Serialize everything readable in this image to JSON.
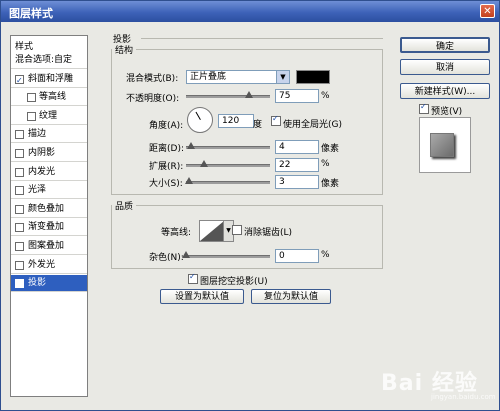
{
  "window": {
    "title": "图层样式",
    "close_glyph": "✕"
  },
  "left_panel": {
    "heading": "样式",
    "items": [
      {
        "label": "混合选项:自定",
        "checkbox": false,
        "checked": false,
        "indent": false,
        "selected": false
      },
      {
        "label": "斜面和浮雕",
        "checkbox": true,
        "checked": true,
        "indent": false,
        "selected": false
      },
      {
        "label": "等高线",
        "checkbox": true,
        "checked": false,
        "indent": true,
        "selected": false
      },
      {
        "label": "纹理",
        "checkbox": true,
        "checked": false,
        "indent": true,
        "selected": false
      },
      {
        "label": "描边",
        "checkbox": true,
        "checked": false,
        "indent": false,
        "selected": false
      },
      {
        "label": "内阴影",
        "checkbox": true,
        "checked": false,
        "indent": false,
        "selected": false
      },
      {
        "label": "内发光",
        "checkbox": true,
        "checked": false,
        "indent": false,
        "selected": false
      },
      {
        "label": "光泽",
        "checkbox": true,
        "checked": false,
        "indent": false,
        "selected": false
      },
      {
        "label": "颜色叠加",
        "checkbox": true,
        "checked": false,
        "indent": false,
        "selected": false
      },
      {
        "label": "渐变叠加",
        "checkbox": true,
        "checked": false,
        "indent": false,
        "selected": false
      },
      {
        "label": "图案叠加",
        "checkbox": true,
        "checked": false,
        "indent": false,
        "selected": false
      },
      {
        "label": "外发光",
        "checkbox": true,
        "checked": false,
        "indent": false,
        "selected": false
      },
      {
        "label": "投影",
        "checkbox": true,
        "checked": true,
        "indent": false,
        "selected": true
      }
    ]
  },
  "drop_shadow": {
    "section_title": "投影",
    "structure": {
      "title": "结构",
      "blend_mode_label": "混合模式(B):",
      "blend_mode_value": "正片叠底",
      "blend_color": "#000000",
      "opacity_label": "不透明度(O):",
      "opacity_value": "75",
      "opacity_level": 0.75,
      "unit_percent": "%",
      "angle_label": "角度(A):",
      "angle_value": "120",
      "angle_unit": "度",
      "global_light_label": "使用全局光(G)",
      "global_light_checked": true,
      "distance_label": "距离(D):",
      "distance_value": "4",
      "distance_level": 0.06,
      "size_unit": "像素",
      "spread_label": "扩展(R):",
      "spread_value": "22",
      "spread_level": 0.22,
      "size_label": "大小(S):",
      "size_value": "3",
      "size_level": 0.04
    },
    "quality": {
      "title": "品质",
      "contour_label": "等高线:",
      "antialias_label": "消除锯齿(L)",
      "antialias_checked": false,
      "noise_label": "杂色(N):",
      "noise_value": "0",
      "noise_level": 0.0
    },
    "knockout_label": "图层挖空投影(U)",
    "knockout_checked": true,
    "set_default_label": "设置为默认值",
    "reset_default_label": "复位为默认值"
  },
  "right_buttons": {
    "ok": "确定",
    "cancel": "取消",
    "new_style": "新建样式(W)...",
    "preview_label": "预览(V)",
    "preview_checked": true
  },
  "watermark": {
    "text": "Bai 经验",
    "sub": "jingyan.baidu.com"
  }
}
